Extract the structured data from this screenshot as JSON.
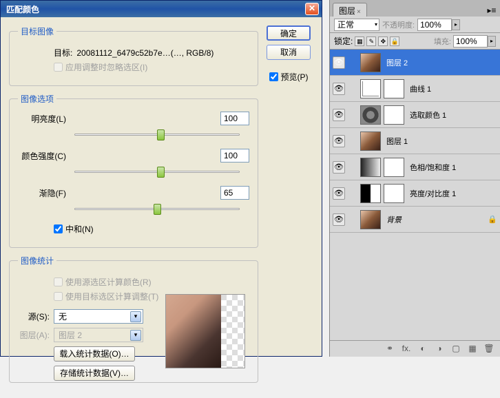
{
  "dialog": {
    "title": "匹配颜色",
    "ok": "确定",
    "cancel": "取消",
    "preview": "预览(P)",
    "target_group": "目标图像",
    "target_label": "目标:",
    "target_value": "20081112_6479c52b7e…(…, RGB/8)",
    "ignore_sel": "应用调整时忽略选区(I)",
    "options_group": "图像选项",
    "lum": {
      "label": "明亮度(L)",
      "value": "100",
      "pos": 50
    },
    "intensity": {
      "label": "颜色强度(C)",
      "value": "100",
      "pos": 50
    },
    "fade": {
      "label": "渐隐(F)",
      "value": "65",
      "pos": 48
    },
    "neutralize": "中和(N)",
    "stats_group": "图像统计",
    "use_src_sel": "使用源选区计算颜色(R)",
    "use_tgt_sel": "使用目标选区计算调整(T)",
    "source_label": "源(S):",
    "source_value": "无",
    "layer_label": "图层(A):",
    "layer_value": "图层 2",
    "load": "载入统计数据(O)…",
    "save": "存储统计数据(V)…"
  },
  "panel": {
    "tab": "图层",
    "mode": "正常",
    "opacity_label": "不透明度:",
    "opacity": "100%",
    "lock_label": "锁定:",
    "fill_label": "填充:",
    "fill": "100%",
    "layers": [
      {
        "name": "图层 2",
        "type": "face",
        "sel": true
      },
      {
        "name": "曲线 1",
        "type": "curve",
        "mask": true
      },
      {
        "name": "选取颜色 1",
        "type": "adj",
        "mask": true
      },
      {
        "name": "图层 1",
        "type": "face"
      },
      {
        "name": "色相/饱和度 1",
        "type": "grad",
        "mask": true
      },
      {
        "name": "亮度/对比度 1",
        "type": "bc",
        "mask": true
      },
      {
        "name": "背景",
        "type": "face",
        "locked": true,
        "bg": true
      }
    ],
    "footer_fx": "fx."
  }
}
